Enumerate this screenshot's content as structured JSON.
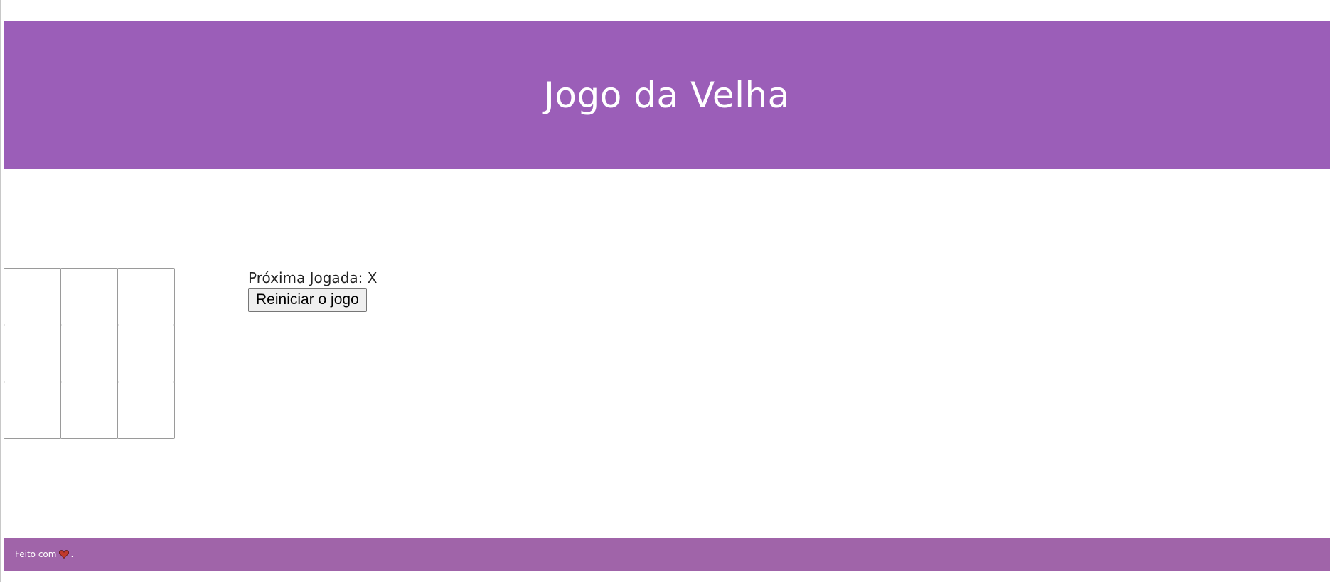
{
  "header": {
    "title": "Jogo da Velha",
    "background": "#9b5eb8"
  },
  "board": {
    "cells": [
      "",
      "",
      "",
      "",
      "",
      "",
      "",
      "",
      ""
    ]
  },
  "status": {
    "text": "Próxima Jogada: X"
  },
  "controls": {
    "restart_label": "Reiniciar o jogo"
  },
  "footer": {
    "prefix": "Feito com",
    "icon": "heart-icon",
    "suffix": ".",
    "background": "#a064a9",
    "heart_color": "#c0392b"
  }
}
